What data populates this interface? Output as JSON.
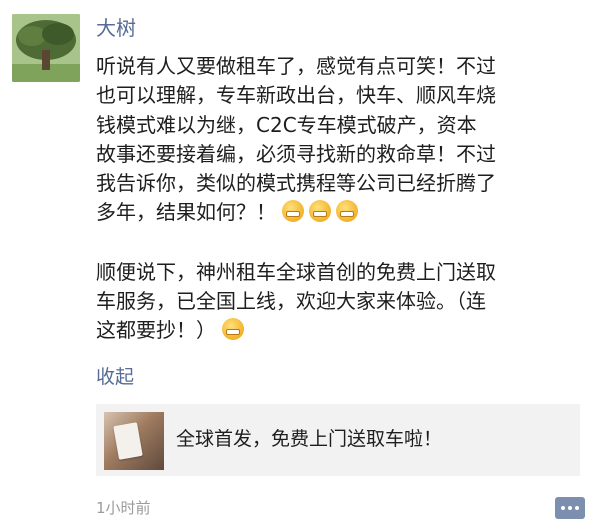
{
  "author": "大树",
  "post": {
    "paragraph1": [
      "听说有人又要做租车了，感觉有点可笑！不过",
      "也可以理解，专车新政出台，快车、顺风车烧",
      "钱模式难以为继，C2C专车模式破产，资本",
      "故事还要接着编，必须寻找新的救命草！不过",
      "我告诉你，类似的模式携程等公司已经折腾了",
      "多年，结果如何？！"
    ],
    "paragraph2": [
      "顺便说下，神州租车全球首创的免费上门送取",
      "车服务，已全国上线，欢迎大家来体验。（连",
      "这都要抄！）"
    ]
  },
  "collapse_label": "收起",
  "shared_link": {
    "title": "全球首发，免费上门送取车啦！"
  },
  "time_ago": "1小时前",
  "icons": {
    "avatar": "tree-photo-avatar",
    "emoji": "grinning-teeth-emoji",
    "comment": "comment-dots-icon"
  }
}
